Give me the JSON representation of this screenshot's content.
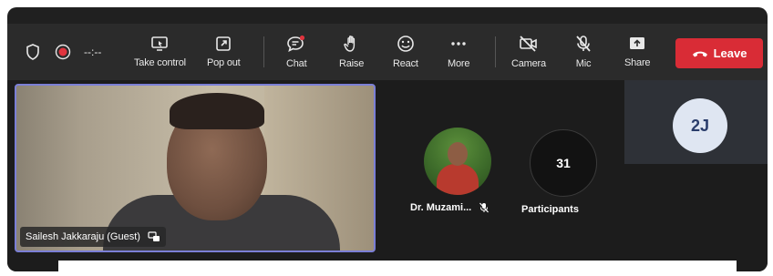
{
  "toolbar": {
    "timer": "--:--",
    "take_control": "Take control",
    "pop_out": "Pop out",
    "chat": "Chat",
    "raise": "Raise",
    "react": "React",
    "more": "More",
    "camera": "Camera",
    "mic": "Mic",
    "share": "Share",
    "leave": "Leave"
  },
  "colors": {
    "leave_button": "#d92c36",
    "active_speaker_border": "#7b7fd6",
    "toolbar_bg": "#2b2b2b",
    "stage_bg": "#1c1c1c"
  },
  "stage": {
    "main_video": {
      "name": "Sailesh Jakkaraju (Guest)"
    },
    "participant_tile": {
      "name": "Dr. Muzami..."
    },
    "participants": {
      "count": "31",
      "label": "Participants"
    },
    "side_tile": {
      "initials": "2J"
    }
  }
}
